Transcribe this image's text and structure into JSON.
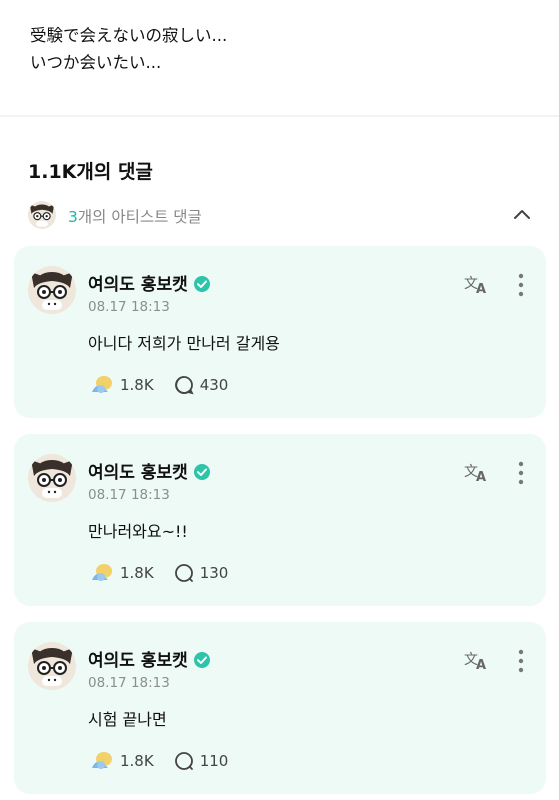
{
  "post": {
    "lines": [
      "受験で会えないの寂しい...",
      "いつか会いたい..."
    ]
  },
  "comments_header": {
    "count_label": "1.1K개의 댓글"
  },
  "artist_comments": {
    "count": "3",
    "label": "개의 아티스트 댓글"
  },
  "comments": [
    {
      "author": "여의도 홍보캣",
      "timestamp": "08.17 18:13",
      "text": "아니다 저희가 만나러 갈게용",
      "likes": "1.8K",
      "replies": "430"
    },
    {
      "author": "여의도 홍보캣",
      "timestamp": "08.17 18:13",
      "text": "만나러와요~!!",
      "likes": "1.8K",
      "replies": "130"
    },
    {
      "author": "여의도 홍보캣",
      "timestamp": "08.17 18:13",
      "text": "시험 끝나면",
      "likes": "1.8K",
      "replies": "110"
    }
  ],
  "icons": {
    "verified": "verified-badge-icon",
    "translate": "translate-icon",
    "more": "more-vertical-icon",
    "like": "like-icon",
    "reply": "reply-bubble-icon",
    "collapse": "chevron-up-icon"
  },
  "colors": {
    "card_background": "#eefaf6",
    "accent": "#19b8a8",
    "verified": "#2ec4a9"
  }
}
